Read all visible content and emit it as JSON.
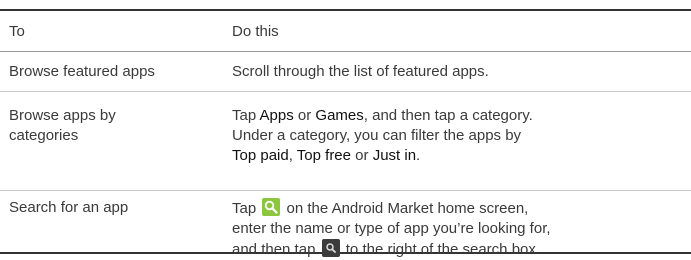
{
  "table": {
    "header": {
      "to": "To",
      "do": "Do this"
    },
    "rows": [
      {
        "to": "Browse featured apps",
        "do": "Scroll through the list of featured apps."
      },
      {
        "to_line1": "Browse apps by",
        "to_line2": "categories",
        "do_tap": "Tap ",
        "do_apps": "Apps",
        "do_or": " or ",
        "do_games": "Games",
        "do_then": ", and then tap a category.",
        "do_line2": "Under a category, you can filter the apps by",
        "do_top_paid": "Top paid",
        "do_comma": ", ",
        "do_top_free": "Top free",
        "do_or2": " or ",
        "do_just_in": "Just in",
        "do_period": "."
      },
      {
        "to": "Search for an app",
        "do_tap": "Tap",
        "do_line1_rest": " on the Android Market home screen,",
        "do_line2": "enter the name or type of app you’re looking for,",
        "do_line3_start": "and then tap",
        "do_line3_end": " to the right of the search box."
      }
    ]
  },
  "icons": {
    "market_search": "search-icon",
    "search_button": "search-icon"
  },
  "colors": {
    "text": "#3a3a3a",
    "emphasis": "#111111",
    "market_search_icon": "#8cc63f",
    "search_button_icon": "#3c3c3c"
  }
}
